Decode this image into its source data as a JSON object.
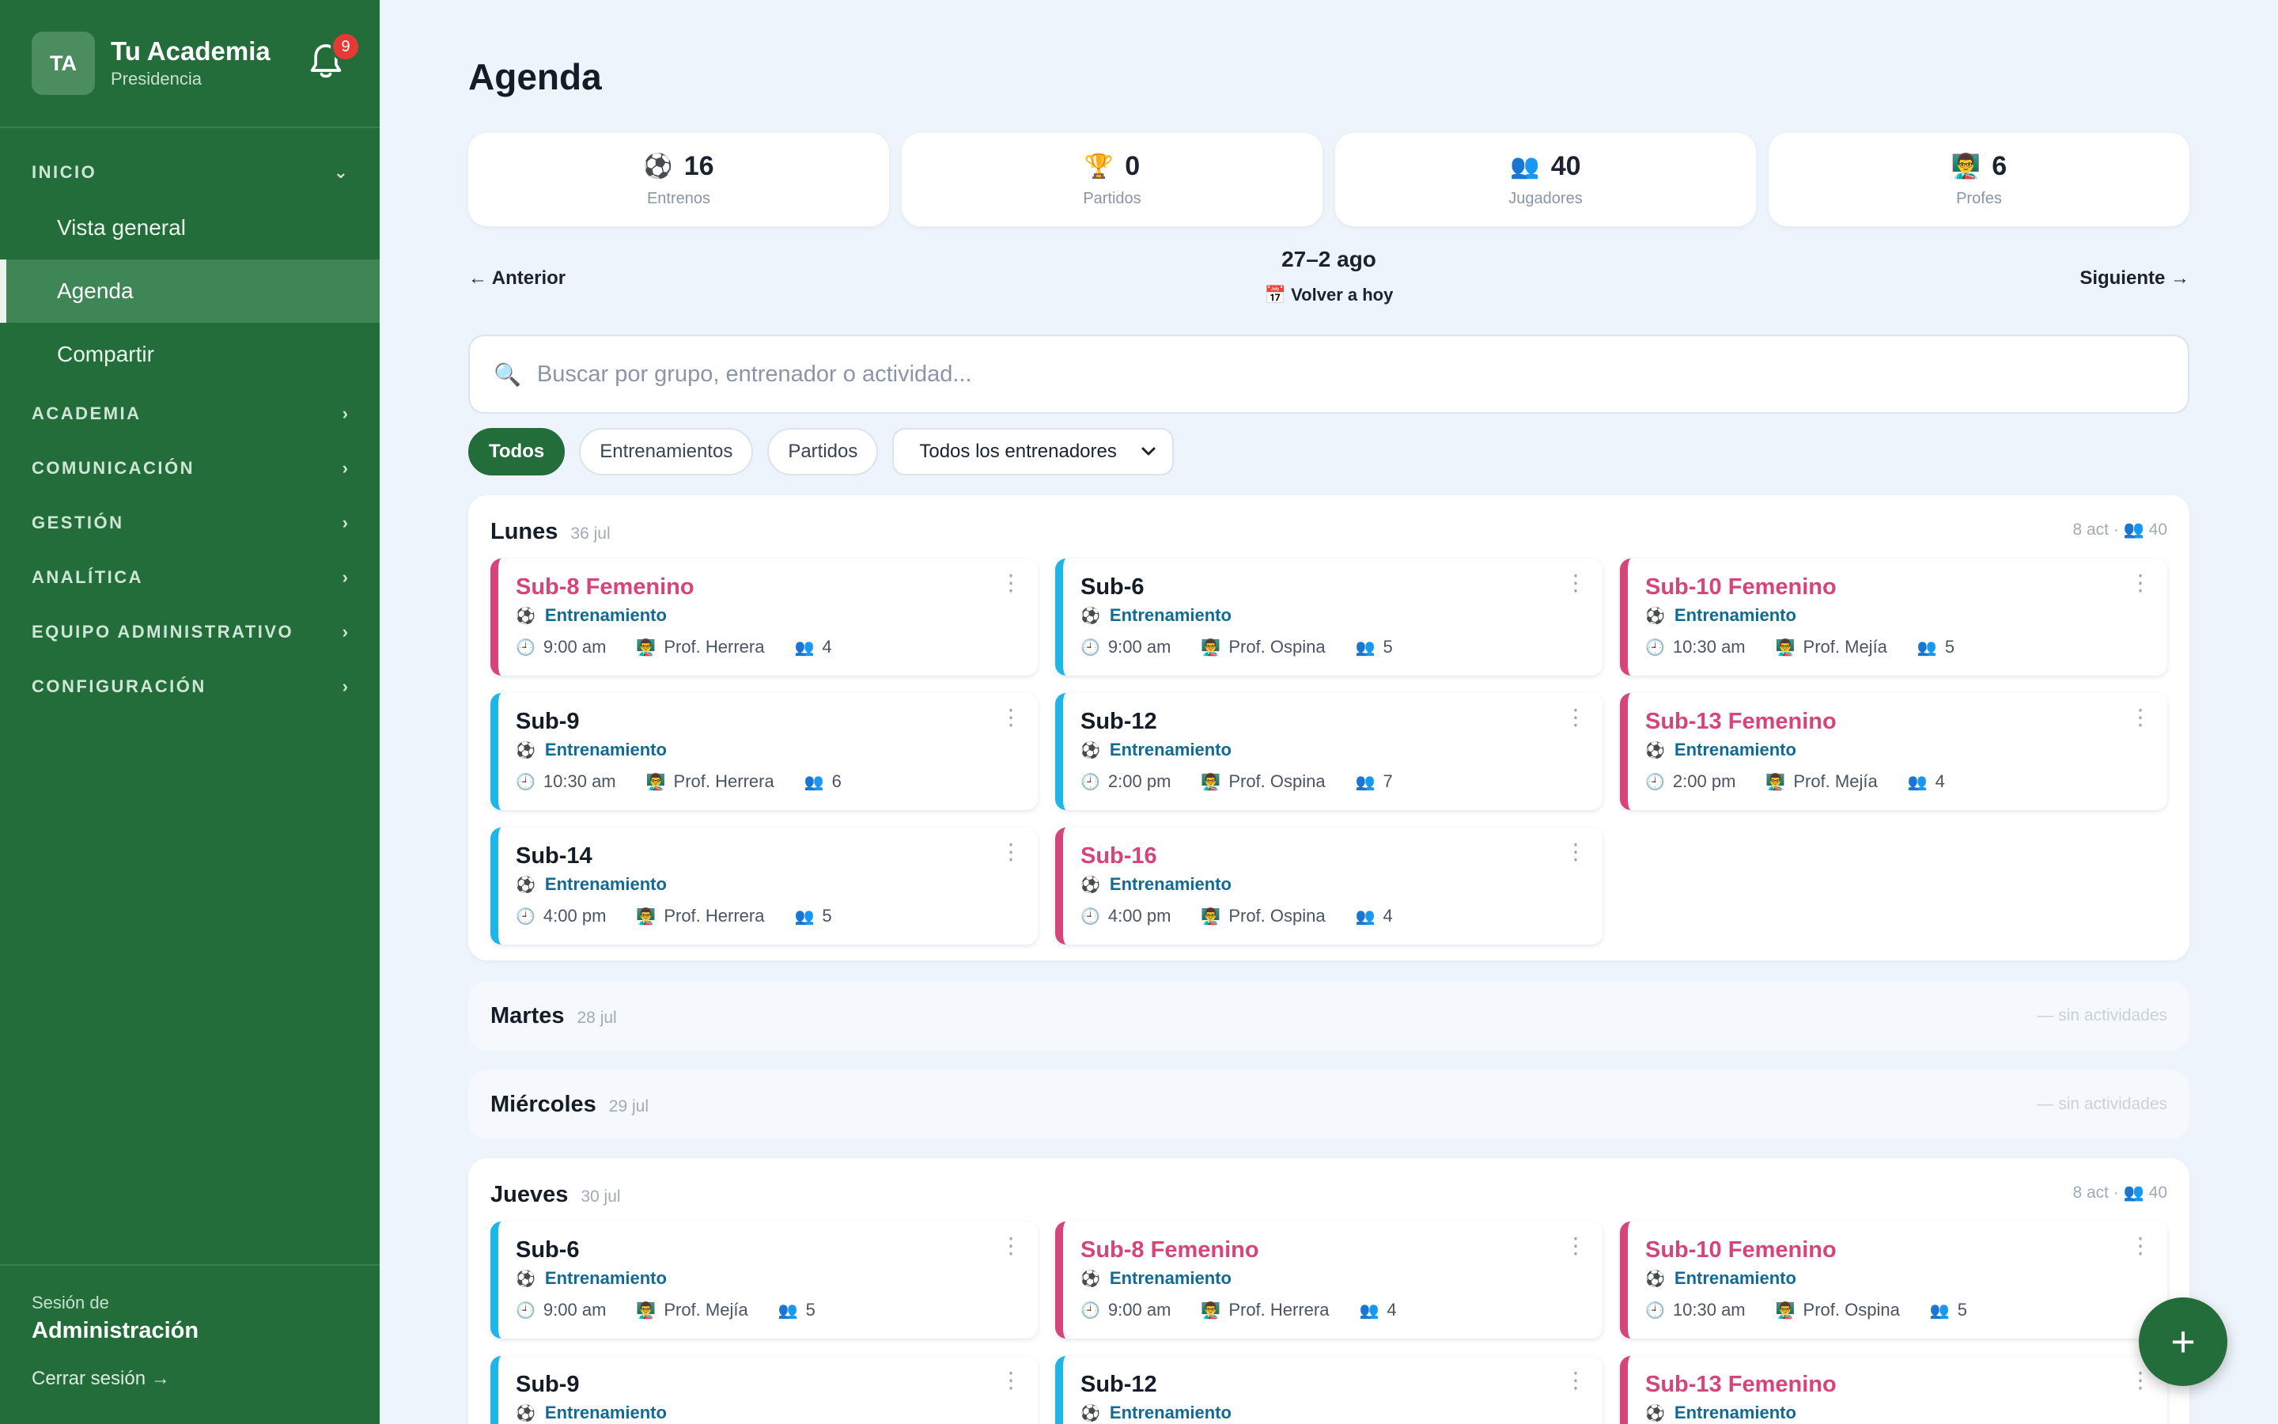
{
  "sidebar": {
    "avatar_initials": "TA",
    "title": "Tu Academia",
    "subtitle": "Presidencia",
    "notification_count": "9",
    "nav": [
      {
        "label": "INICIO",
        "expanded": true
      },
      {
        "label": "ACADEMIA"
      },
      {
        "label": "COMUNICACIÓN"
      },
      {
        "label": "GESTIÓN"
      },
      {
        "label": "ANALÍTICA"
      },
      {
        "label": "EQUIPO ADMINISTRATIVO"
      },
      {
        "label": "CONFIGURACIÓN"
      }
    ],
    "inicio_items": [
      "Vista general",
      "Agenda",
      "Compartir"
    ],
    "active_item": "Agenda",
    "session_label": "Sesión de",
    "session_name": "Administración",
    "logout": "Cerrar sesión →"
  },
  "main": {
    "title": "Agenda",
    "stats": [
      {
        "icon": "⚽",
        "value": "16",
        "label": "Entrenos"
      },
      {
        "icon": "🏆",
        "value": "0",
        "label": "Partidos"
      },
      {
        "icon": "👥",
        "value": "40",
        "label": "Jugadores"
      },
      {
        "icon": "👨‍🏫",
        "value": "6",
        "label": "Profes"
      }
    ],
    "prev": "← Anterior",
    "next": "Siguiente →",
    "week_range": "27–2 ago",
    "today": "📅 Volver a hoy",
    "search_placeholder": "Buscar por grupo, entrenador o actividad...",
    "filters": [
      "Todos",
      "Entrenamientos",
      "Partidos"
    ],
    "coach_select": "Todos los entrenadores",
    "days": [
      {
        "name": "Lunes",
        "date": "36 jul",
        "meta": "8 act · 👥 40",
        "cards": [
          {
            "title": "Sub-8 Femenino",
            "type": "Entrenamiento",
            "time": "9:00 am",
            "coach": "Prof. Herrera",
            "players": "4",
            "color": "pink"
          },
          {
            "title": "Sub-6",
            "type": "Entrenamiento",
            "time": "9:00 am",
            "coach": "Prof. Ospina",
            "players": "5",
            "color": "blue"
          },
          {
            "title": "Sub-10 Femenino",
            "type": "Entrenamiento",
            "time": "10:30 am",
            "coach": "Prof. Mejía",
            "players": "5",
            "color": "pink"
          },
          {
            "title": "Sub-9",
            "type": "Entrenamiento",
            "time": "10:30 am",
            "coach": "Prof. Herrera",
            "players": "6",
            "color": "blue"
          },
          {
            "title": "Sub-12",
            "type": "Entrenamiento",
            "time": "2:00 pm",
            "coach": "Prof. Ospina",
            "players": "7",
            "color": "blue"
          },
          {
            "title": "Sub-13 Femenino",
            "type": "Entrenamiento",
            "time": "2:00 pm",
            "coach": "Prof. Mejía",
            "players": "4",
            "color": "pink"
          },
          {
            "title": "Sub-14",
            "type": "Entrenamiento",
            "time": "4:00 pm",
            "coach": "Prof. Herrera",
            "players": "5",
            "color": "blue"
          },
          {
            "title": "Sub-16",
            "type": "Entrenamiento",
            "time": "4:00 pm",
            "coach": "Prof. Ospina",
            "players": "4",
            "color": "pink"
          }
        ]
      },
      {
        "name": "Martes",
        "date": "28 jul",
        "meta": "— sin actividades",
        "cards": []
      },
      {
        "name": "Miércoles",
        "date": "29 jul",
        "meta": "— sin actividades",
        "cards": []
      },
      {
        "name": "Jueves",
        "date": "30 jul",
        "meta": "8 act · 👥 40",
        "cards": [
          {
            "title": "Sub-6",
            "type": "Entrenamiento",
            "time": "9:00 am",
            "coach": "Prof. Mejía",
            "players": "5",
            "color": "blue"
          },
          {
            "title": "Sub-8 Femenino",
            "type": "Entrenamiento",
            "time": "9:00 am",
            "coach": "Prof. Herrera",
            "players": "4",
            "color": "pink"
          },
          {
            "title": "Sub-10 Femenino",
            "type": "Entrenamiento",
            "time": "10:30 am",
            "coach": "Prof. Ospina",
            "players": "5",
            "color": "pink"
          },
          {
            "title": "Sub-9",
            "type": "Entrenamiento",
            "time": "",
            "coach": "",
            "players": "",
            "color": "blue"
          },
          {
            "title": "Sub-12",
            "type": "Entrenamiento",
            "time": "",
            "coach": "",
            "players": "",
            "color": "blue"
          },
          {
            "title": "Sub-13 Femenino",
            "type": "Entrenamiento",
            "time": "",
            "coach": "",
            "players": "",
            "color": "pink"
          }
        ]
      }
    ],
    "fab": "+"
  },
  "colors": {
    "sidebar": "#226d3a",
    "pink": "#d64579",
    "blue": "#1eb6e8",
    "type_text": "#126a94"
  }
}
